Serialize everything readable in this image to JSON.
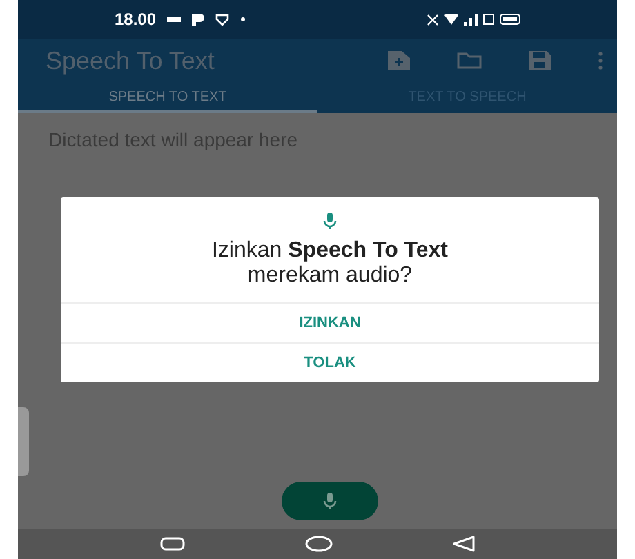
{
  "status_bar": {
    "time": "18.00"
  },
  "app_bar": {
    "title": "Speech To Text"
  },
  "tabs": [
    {
      "label": "SPEECH TO TEXT",
      "selected": true
    },
    {
      "label": "TEXT TO SPEECH",
      "selected": false
    }
  ],
  "editor": {
    "placeholder": "Dictated text will appear here"
  },
  "dialog": {
    "message": "Izinkan **Speech To Text** merekam audio?",
    "buttons": [
      "IZINKAN",
      "TOLAK"
    ]
  }
}
